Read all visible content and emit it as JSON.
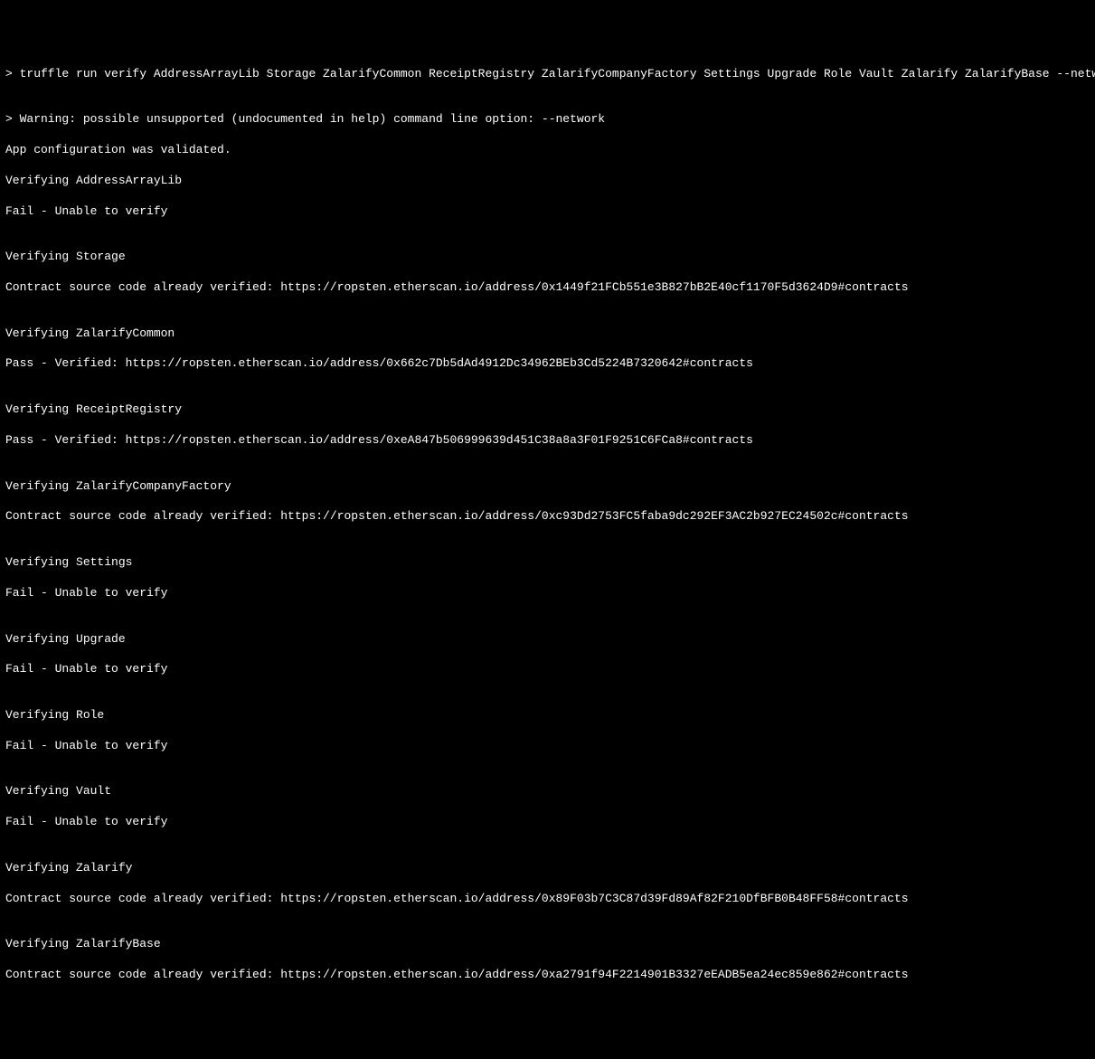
{
  "command": "> truffle run verify AddressArrayLib Storage ZalarifyCommon ReceiptRegistry ZalarifyCompanyFactory Settings Upgrade Role Vault Zalarify ZalarifyBase --network infuraRopsten",
  "warning": "> Warning: possible unsupported (undocumented in help) command line option: --network",
  "config_validated": "App configuration was validated.",
  "verifications": [
    {
      "verifying_line": "Verifying AddressArrayLib",
      "result_line": "Fail - Unable to verify"
    },
    {
      "verifying_line": "Verifying Storage",
      "result_line": "Contract source code already verified: https://ropsten.etherscan.io/address/0x1449f21FCb551e3B827bB2E40cf1170F5d3624D9#contracts"
    },
    {
      "verifying_line": "Verifying ZalarifyCommon",
      "result_line": "Pass - Verified: https://ropsten.etherscan.io/address/0x662c7Db5dAd4912Dc34962BEb3Cd5224B7320642#contracts"
    },
    {
      "verifying_line": "Verifying ReceiptRegistry",
      "result_line": "Pass - Verified: https://ropsten.etherscan.io/address/0xeA847b506999639d451C38a8a3F01F9251C6FCa8#contracts"
    },
    {
      "verifying_line": "Verifying ZalarifyCompanyFactory",
      "result_line": "Contract source code already verified: https://ropsten.etherscan.io/address/0xc93Dd2753FC5faba9dc292EF3AC2b927EC24502c#contracts"
    },
    {
      "verifying_line": "Verifying Settings",
      "result_line": "Fail - Unable to verify"
    },
    {
      "verifying_line": "Verifying Upgrade",
      "result_line": "Fail - Unable to verify"
    },
    {
      "verifying_line": "Verifying Role",
      "result_line": "Fail - Unable to verify"
    },
    {
      "verifying_line": "Verifying Vault",
      "result_line": "Fail - Unable to verify"
    },
    {
      "verifying_line": "Verifying Zalarify",
      "result_line": "Contract source code already verified: https://ropsten.etherscan.io/address/0x89F03b7C3C87d39Fd89Af82F210DfBFB0B48FF58#contracts"
    },
    {
      "verifying_line": "Verifying ZalarifyBase",
      "result_line": "Contract source code already verified: https://ropsten.etherscan.io/address/0xa2791f94F2214901B3327eEADB5ea24ec859e862#contracts"
    }
  ]
}
